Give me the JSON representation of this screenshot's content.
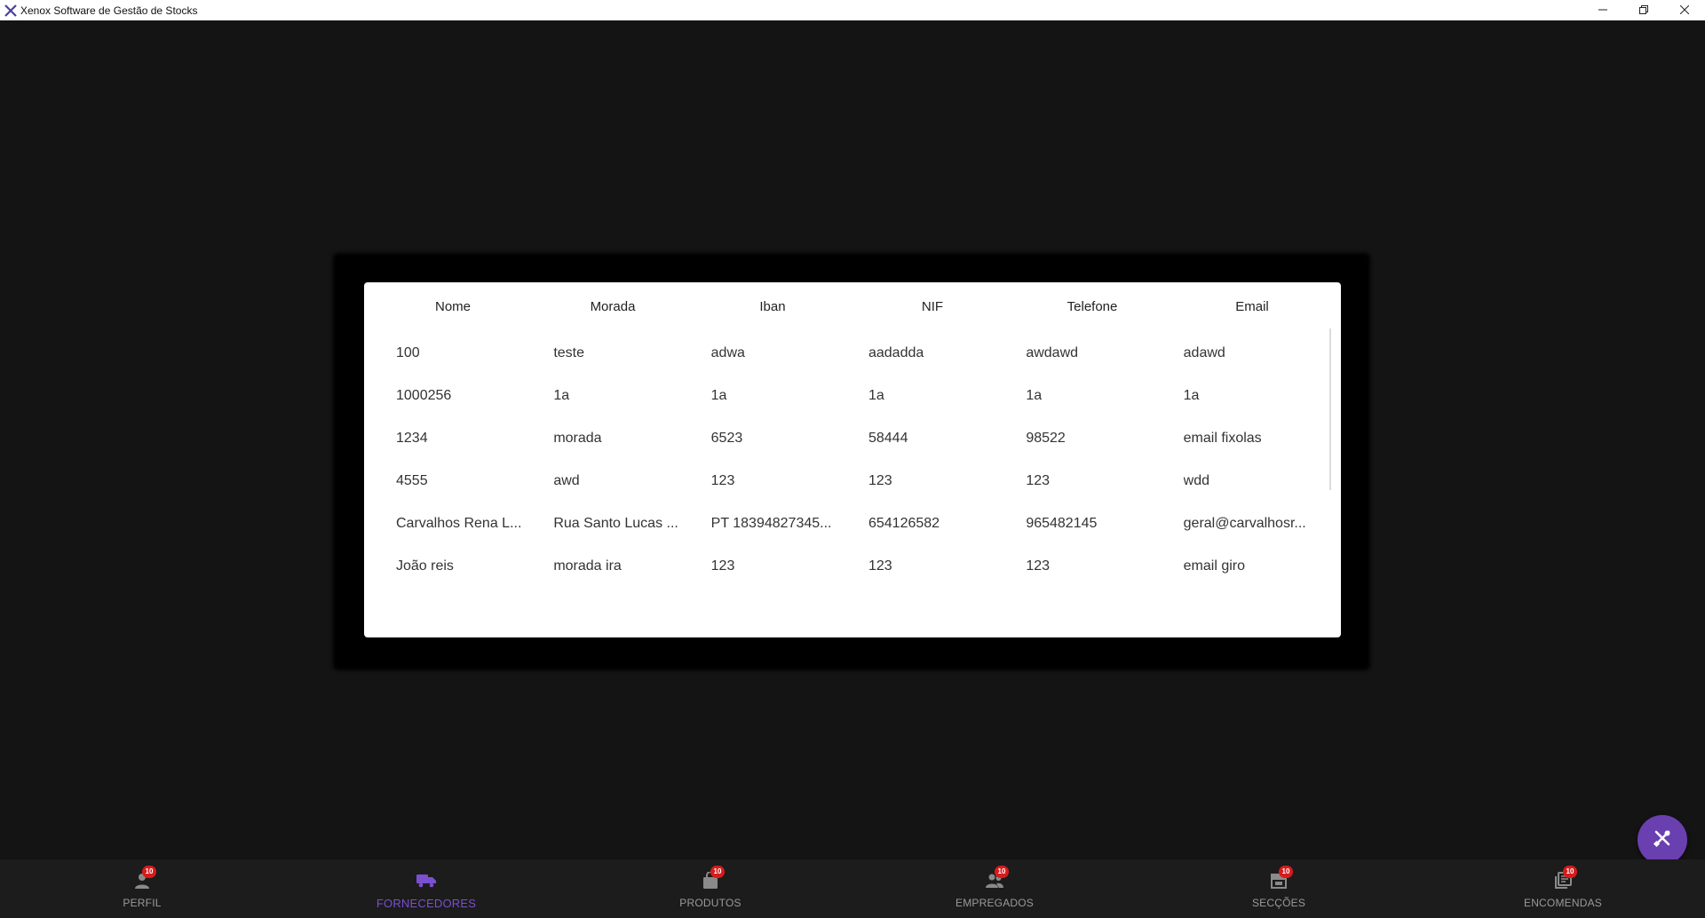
{
  "window": {
    "title": "Xenox Software de Gestão de Stocks",
    "controls": {
      "minimize_icon": "minimize-icon",
      "restore_icon": "restore-icon",
      "close_icon": "close-icon"
    }
  },
  "table": {
    "headers": [
      "Nome",
      "Morada",
      "Iban",
      "NIF",
      "Telefone",
      "Email"
    ],
    "rows": [
      [
        "100",
        "teste",
        "adwa",
        "aadadda",
        "awdawd",
        "adawd"
      ],
      [
        "1000256",
        "1a",
        "1a",
        "1a",
        "1a",
        "1a"
      ],
      [
        "1234",
        "morada",
        "6523",
        "58444",
        "98522",
        "email fixolas"
      ],
      [
        "4555",
        "awd",
        "123",
        "123",
        "123",
        "wdd"
      ],
      [
        "Carvalhos Rena L...",
        "Rua Santo Lucas ...",
        "PT 18394827345...",
        "654126582",
        "965482145",
        "geral@carvalhosr..."
      ],
      [
        "João reis",
        "morada ira",
        "123",
        "123",
        "123",
        "email giro"
      ]
    ]
  },
  "fab": {
    "icon": "tools-icon",
    "color": "#6a3fb0"
  },
  "bottom_nav": {
    "active_color": "#7a4fd0",
    "badge_color": "#d81b1b",
    "items": [
      {
        "label": "PERFIL",
        "icon": "person-icon",
        "badge": "10",
        "active": false
      },
      {
        "label": "FORNECEDORES",
        "icon": "truck-icon",
        "badge": "",
        "active": true
      },
      {
        "label": "PRODUTOS",
        "icon": "shopping-bag-icon",
        "badge": "10",
        "active": false
      },
      {
        "label": "EMPREGADOS",
        "icon": "people-icon",
        "badge": "10",
        "active": false
      },
      {
        "label": "SECÇÕES",
        "icon": "store-icon",
        "badge": "10",
        "active": false
      },
      {
        "label": "ENCOMENDAS",
        "icon": "orders-icon",
        "badge": "10",
        "active": false
      }
    ]
  }
}
